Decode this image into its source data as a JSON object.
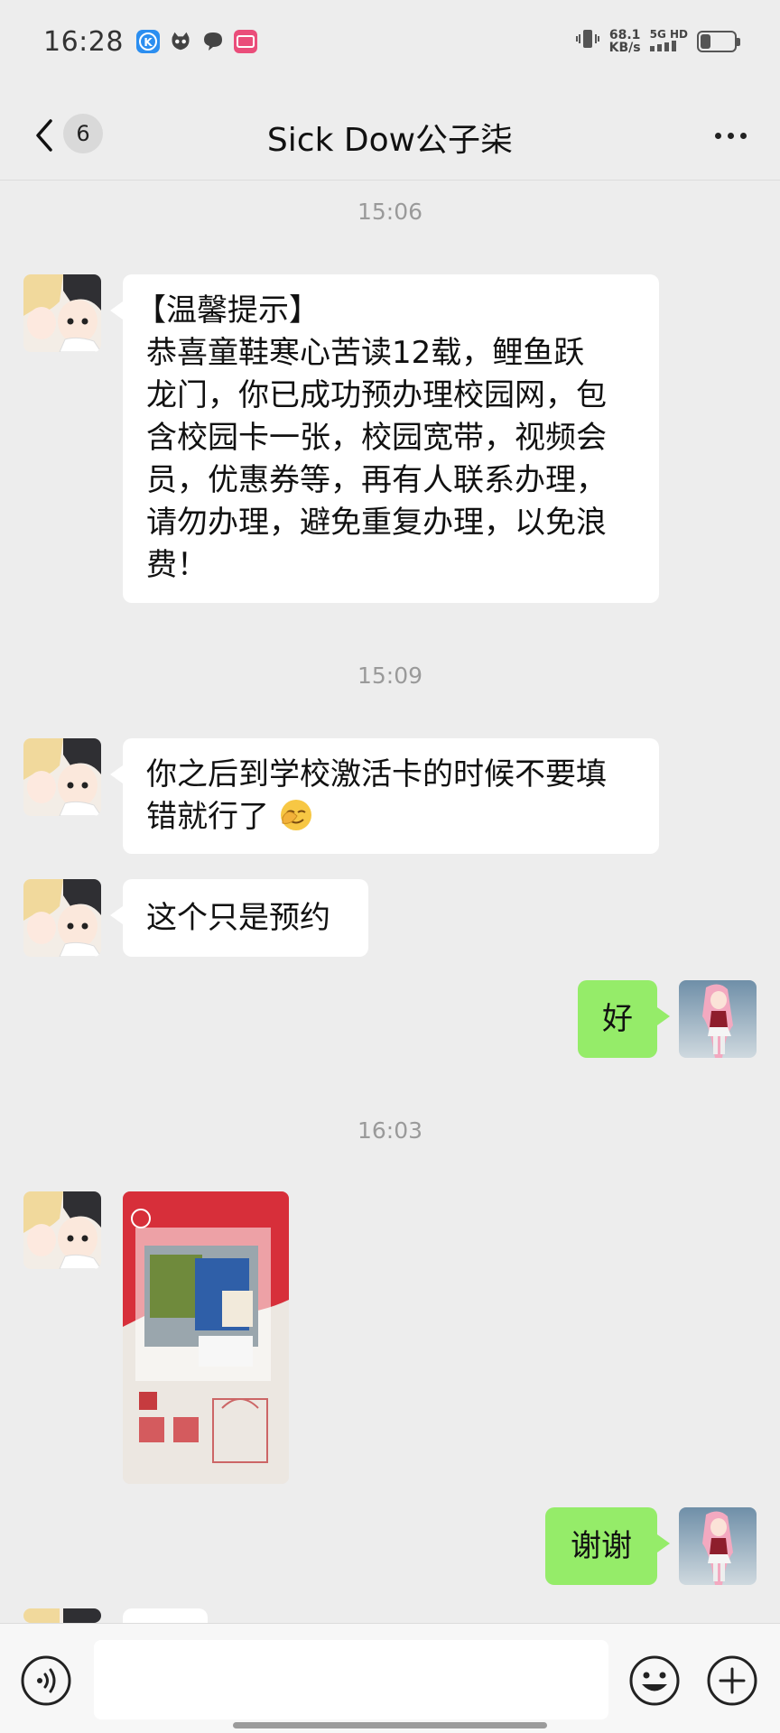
{
  "status_bar": {
    "time": "16:28",
    "net_speed": "68.1",
    "net_unit": "KB/s",
    "net_type": "5G HD",
    "battery_level": 0.3,
    "notification_icons": [
      "k-app-icon",
      "cat-app-icon",
      "chat-bubble-icon",
      "pink-app-icon"
    ]
  },
  "header": {
    "unread_count": "6",
    "title": "Sick Dow公子柒"
  },
  "messages": {
    "ts1": "15:06",
    "m1_line1": "【温馨提示】",
    "m1_line2": "恭喜童鞋寒心苦读12载，鲤鱼跃",
    "m1_line3": "龙门，你已成功预办理校园网，包",
    "m1_line4": "含校园卡一张，校园宽带，视频会",
    "m1_line5": "员，优惠券等，再有人联系办理，",
    "m1_line6": "请勿办理，避免重复办理，以免浪",
    "m1_line7": "费！",
    "ts2": "15:09",
    "m2_line1": "你之后到学校激活卡的时候不要填",
    "m2_line2": "错就行了",
    "m3": "这个只是预约",
    "m4": "好",
    "ts3": "16:03",
    "m5_image": "photo-message",
    "m6": "谢谢"
  },
  "colors": {
    "background": "#ededed",
    "incoming_bubble": "#ffffff",
    "outgoing_bubble": "#95ec69",
    "timestamp": "#9a9a9a"
  },
  "input_bar": {
    "icons": [
      "voice-icon",
      "emoji-icon",
      "plus-icon"
    ]
  }
}
